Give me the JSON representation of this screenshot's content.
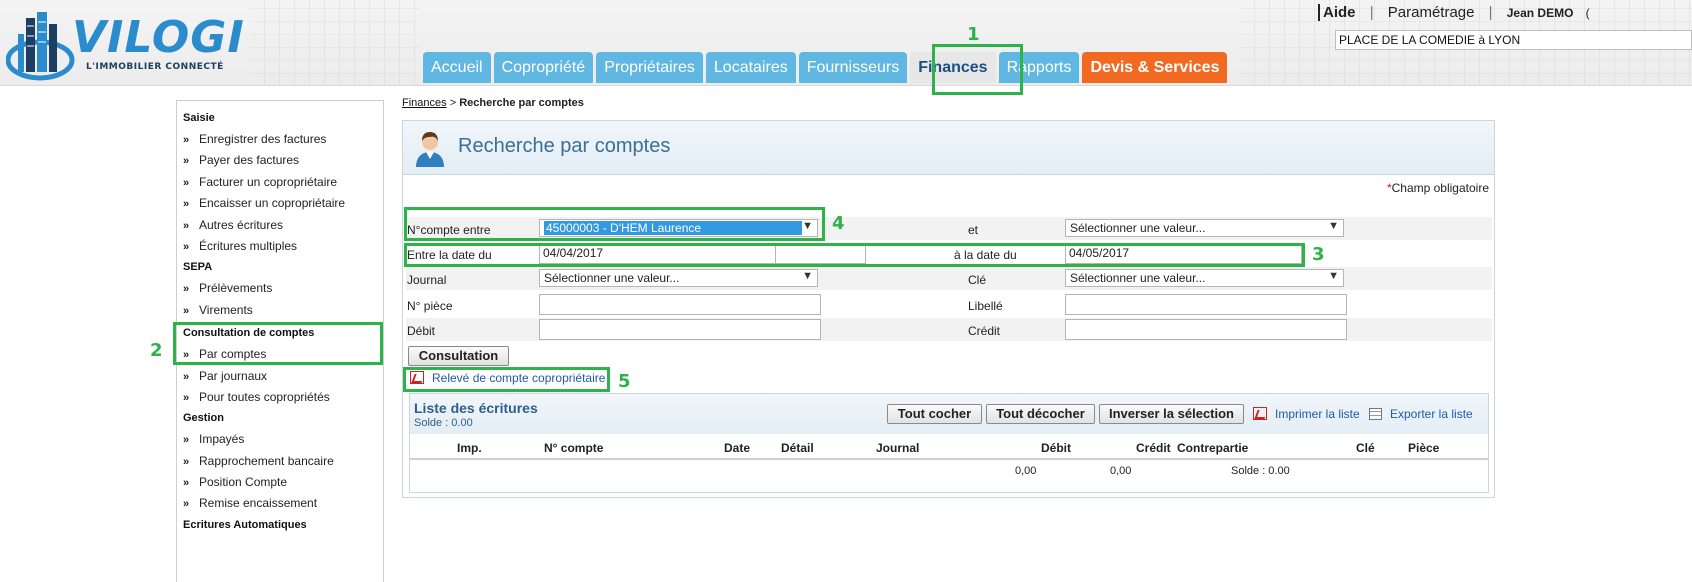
{
  "brand": {
    "name": "VILOGI",
    "tagline": "L'IMMOBILIER CONNECTÉ"
  },
  "toplinks": {
    "help": "Aide",
    "settings": "Paramétrage",
    "user": "Jean DEMO",
    "user_suffix": "("
  },
  "residence": "PLACE DE LA COMEDIE à LYON",
  "tabs": [
    {
      "label": "Accueil"
    },
    {
      "label": "Copropriété"
    },
    {
      "label": "Propriétaires"
    },
    {
      "label": "Locataires"
    },
    {
      "label": "Fournisseurs"
    },
    {
      "label": "Finances",
      "active": true
    },
    {
      "label": "Rapports"
    },
    {
      "label": "Devis & Services",
      "highlight": "#f26a21"
    }
  ],
  "sidebar": {
    "sections": [
      {
        "title": "Saisie",
        "items": [
          "Enregistrer des factures",
          "Payer des factures",
          "Facturer un copropriétaire",
          "Encaisser un copropriétaire",
          "Autres écritures",
          "Écritures multiples"
        ]
      },
      {
        "title": "SEPA",
        "items": [
          "Prélèvements",
          "Virements"
        ]
      },
      {
        "title": "Consultation de comptes",
        "items": [
          "Par comptes",
          "Par journaux",
          "Pour toutes copropriétés"
        ]
      },
      {
        "title": "Gestion",
        "items": [
          "Impayés",
          "Rapprochement bancaire",
          "Position Compte",
          "Remise encaissement"
        ]
      },
      {
        "title": "Ecritures Automatiques",
        "items": []
      }
    ]
  },
  "breadcrumb": {
    "link": "Finances",
    "separator": ">",
    "current": "Recherche par comptes"
  },
  "panel": {
    "title": "Recherche par comptes",
    "required_star": "*",
    "required_note": "Champ obligatoire",
    "form": {
      "account_label": "N°compte entre",
      "account_value": "45000003 - D'HEM Laurence",
      "and_label": "et",
      "and_value": "Sélectionner une valeur...",
      "date_from_label": "Entre la date du",
      "date_from_value": "04/04/2017",
      "date_to_label": "à la date du",
      "date_to_value": "04/05/2017",
      "journal_label": "Journal",
      "journal_value": "Sélectionner une valeur...",
      "key_label": "Clé",
      "key_value": "Sélectionner une valeur...",
      "piece_label": "N° pièce",
      "libelle_label": "Libellé",
      "debit_label": "Débit",
      "credit_label": "Crédit"
    },
    "consult_button": "Consultation",
    "releve_link": "Relevé de compte copropriétaire"
  },
  "list": {
    "title": "Liste des écritures",
    "solde": "Solde : 0.00",
    "buttons": [
      "Tout cocher",
      "Tout décocher",
      "Inverser la sélection"
    ],
    "print_link": "Imprimer la liste",
    "export_link": "Exporter la liste",
    "columns": [
      "Imp.",
      "N° compte",
      "Date",
      "Détail",
      "Journal",
      "Débit",
      "Crédit",
      "Contrepartie",
      "Clé",
      "Pièce"
    ],
    "totals": {
      "debit": "0,00",
      "credit": "0,00",
      "solde": "Solde : 0.00"
    }
  },
  "annotations": [
    "1",
    "2",
    "3",
    "4",
    "5"
  ],
  "colors": {
    "annotation": "#2eb34a",
    "tab": "#5fb7e2",
    "tab_orange": "#f26a21",
    "title": "#3a6f96"
  }
}
